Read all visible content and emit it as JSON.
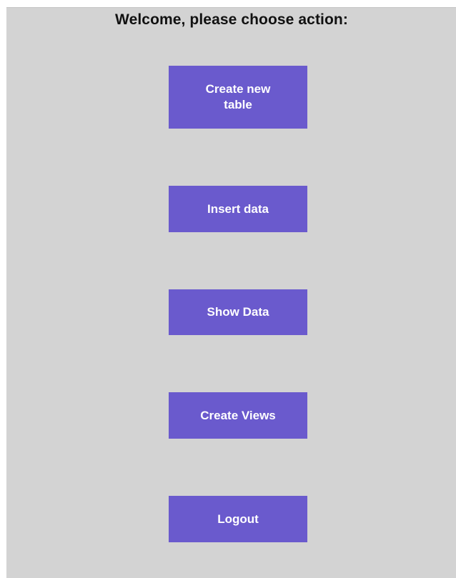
{
  "header": {
    "title": "Welcome, please choose action:"
  },
  "actions": {
    "create_table_label": "Create new table",
    "insert_data_label": "Insert data",
    "show_data_label": "Show Data",
    "create_views_label": "Create Views",
    "logout_label": "Logout"
  },
  "colors": {
    "background": "#d3d3d3",
    "button": "#6a5acd",
    "button_text": "#ffffff",
    "title_text": "#111111"
  }
}
